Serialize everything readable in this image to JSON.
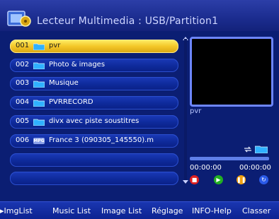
{
  "header": {
    "title": "Lecteur Multimedia : USB/Partition1",
    "icon": "media-player-icon"
  },
  "files": [
    {
      "num": "001",
      "icon": "folder-icon",
      "label": "pvr",
      "selected": true
    },
    {
      "num": "002",
      "icon": "folder-icon",
      "label": "Photo & images"
    },
    {
      "num": "003",
      "icon": "folder-icon",
      "label": "Musique"
    },
    {
      "num": "004",
      "icon": "folder-icon",
      "label": "PVRRECORD"
    },
    {
      "num": "005",
      "icon": "folder-icon",
      "label": "divx avec piste soustitres"
    },
    {
      "num": "006",
      "icon": "mpg-file-icon",
      "badge": "MPG",
      "label": "France 3 (090305_145550).m"
    }
  ],
  "preview": {
    "name": "pvr",
    "time_start": "00:00:00",
    "time_end": "00:00:00",
    "progress_fraction": 0.0
  },
  "colors": {
    "selected": "#f4c728",
    "red": "#e02020",
    "green": "#22b022",
    "yellow": "#f0a010",
    "blue": "#2a5ae8"
  },
  "footer": {
    "imglist": "ImgList",
    "music_list": "Music List",
    "image_list": "Image List",
    "reglage": "Réglage",
    "info_help": "INFO-Help",
    "classer": "Classer"
  }
}
